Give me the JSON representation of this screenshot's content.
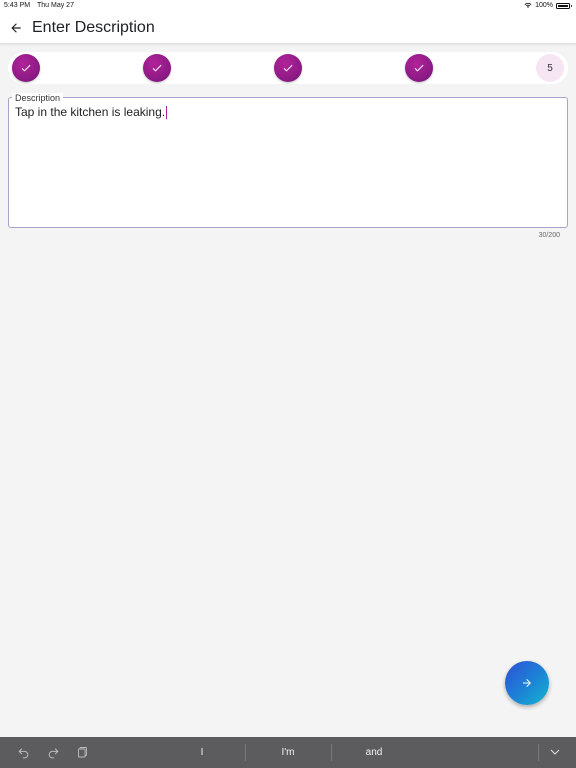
{
  "status_bar": {
    "time": "5:43 PM",
    "date": "Thu May 27",
    "battery": "100%"
  },
  "app_bar": {
    "title": "Enter Description",
    "back_icon": "arrow-left-icon"
  },
  "stepper": {
    "steps": [
      {
        "state": "done",
        "icon": "check-icon"
      },
      {
        "state": "done",
        "icon": "check-icon"
      },
      {
        "state": "done",
        "icon": "check-icon"
      },
      {
        "state": "done",
        "icon": "check-icon"
      },
      {
        "state": "current",
        "label": "5"
      }
    ]
  },
  "description": {
    "label": "Description",
    "value": "Tap in the kitchen is leaking.",
    "counter": "30/200"
  },
  "fab": {
    "icon": "arrow-right-icon"
  },
  "keyboard": {
    "suggestions": [
      "I",
      "I'm",
      "and"
    ],
    "tools": [
      "undo-icon",
      "redo-icon",
      "paste-icon",
      "chevron-down-icon"
    ]
  },
  "colors": {
    "accent": "#8e1b86",
    "step_current_bg": "#f6e6f3",
    "fab_gradient_start": "#2f4fd6",
    "fab_gradient_end": "#13b7d0",
    "keyboard_bar": "#5c5c5e"
  }
}
